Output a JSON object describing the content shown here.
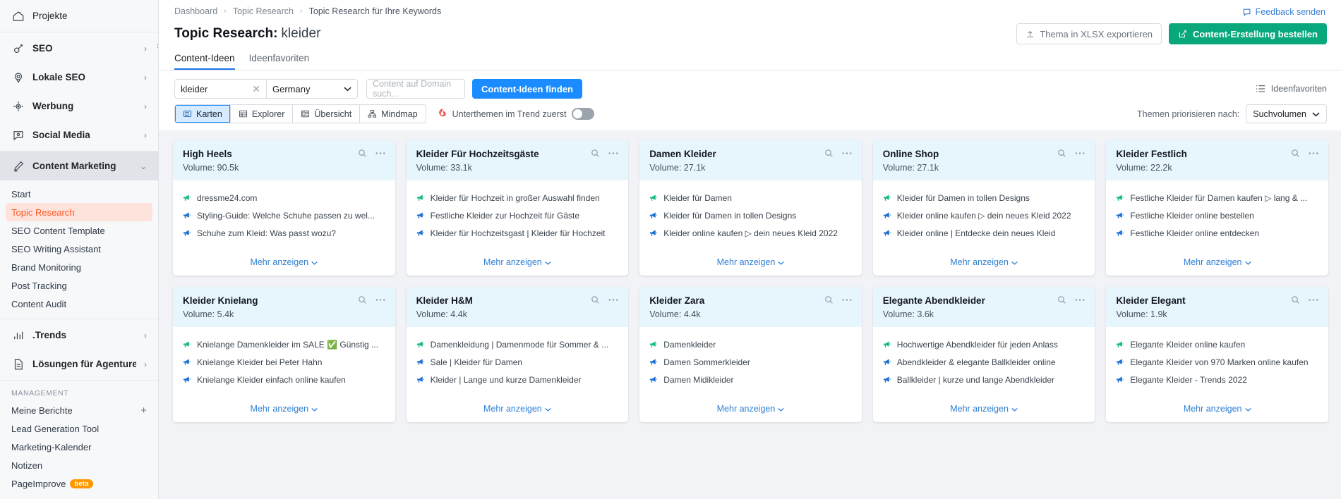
{
  "sidebar": {
    "groups": [
      {
        "items": [
          {
            "label": "Projekte",
            "icon": "home-icon",
            "chevron": false,
            "bold": false
          }
        ]
      },
      {
        "items": [
          {
            "label": "SEO",
            "icon": "seo-icon",
            "chevron": true,
            "bold": true
          },
          {
            "label": "Lokale SEO",
            "icon": "location-icon",
            "chevron": true,
            "bold": true
          },
          {
            "label": "Werbung",
            "icon": "target-icon",
            "chevron": true,
            "bold": true
          },
          {
            "label": "Social Media",
            "icon": "social-icon",
            "chevron": true,
            "bold": true
          }
        ]
      }
    ],
    "content_marketing": {
      "label": "Content Marketing",
      "icon": "pencil-icon",
      "expanded": true
    },
    "content_items": [
      {
        "label": "Start",
        "selected": false
      },
      {
        "label": "Topic Research",
        "selected": true
      },
      {
        "label": "SEO Content Template",
        "selected": false
      },
      {
        "label": "SEO Writing Assistant",
        "selected": false
      },
      {
        "label": "Brand Monitoring",
        "selected": false
      },
      {
        "label": "Post Tracking",
        "selected": false
      },
      {
        "label": "Content Audit",
        "selected": false
      }
    ],
    "bottom_groups": [
      {
        "label": ".Trends",
        "icon": "bars-icon",
        "chevron": true,
        "bold": true
      },
      {
        "label": "Lösungen für Agenturen",
        "icon": "document-icon",
        "chevron": true,
        "bold": true
      }
    ],
    "management_label": "MANAGEMENT",
    "management_items": [
      {
        "label": "Meine Berichte",
        "plus": true,
        "beta": false
      },
      {
        "label": "Lead Generation Tool",
        "plus": false,
        "beta": false
      },
      {
        "label": "Marketing-Kalender",
        "plus": false,
        "beta": false
      },
      {
        "label": "Notizen",
        "plus": false,
        "beta": false
      },
      {
        "label": "PageImprove",
        "plus": false,
        "beta": true,
        "beta_label": "beta"
      }
    ]
  },
  "header": {
    "breadcrumb": [
      "Dashboard",
      "Topic Research",
      "Topic Research für Ihre Keywords"
    ],
    "feedback_label": "Feedback senden",
    "title": "Topic Research:",
    "keyword": "kleider",
    "export_button": "Thema in XLSX exportieren",
    "order_button": "Content-Erstellung bestellen",
    "tabs": [
      {
        "label": "Content-Ideen",
        "active": true
      },
      {
        "label": "Ideenfavoriten",
        "active": false
      }
    ]
  },
  "filters": {
    "keyword_value": "kleider",
    "database_value": "Germany",
    "domain_placeholder": "Content auf Domain such...",
    "find_button": "Content-Ideen finden",
    "favorites_link": "Ideenfavoriten"
  },
  "viewbar": {
    "views": [
      {
        "label": "Karten",
        "icon": "cards-icon",
        "active": true
      },
      {
        "label": "Explorer",
        "icon": "table-icon",
        "active": false
      },
      {
        "label": "Übersicht",
        "icon": "overview-icon",
        "active": false
      },
      {
        "label": "Mindmap",
        "icon": "mindmap-icon",
        "active": false
      }
    ],
    "trend_label": "Unterthemen im Trend zuerst",
    "trend_on": false,
    "priority_label": "Themen priorisieren nach:",
    "priority_value": "Suchvolumen"
  },
  "cards": {
    "more_label": "Mehr anzeigen",
    "volume_prefix": "Volume:",
    "rows": [
      [
        {
          "title": "High Heels",
          "volume": "Volume: 90.5k",
          "ideas": [
            {
              "text": "dressme24.com",
              "color": "green"
            },
            {
              "text": "Styling-Guide: Welche Schuhe passen zu wel...",
              "color": "blue"
            },
            {
              "text": "Schuhe zum Kleid: Was passt wozu?",
              "color": "blue"
            }
          ]
        },
        {
          "title": "Kleider Für Hochzeitsgäste",
          "volume": "Volume: 33.1k",
          "ideas": [
            {
              "text": "Kleider für Hochzeit in großer Auswahl finden",
              "color": "green"
            },
            {
              "text": "Festliche Kleider zur Hochzeit für Gäste",
              "color": "blue"
            },
            {
              "text": "Kleider für Hochzeitsgast | Kleider für Hochzeit",
              "color": "blue"
            }
          ]
        },
        {
          "title": "Damen Kleider",
          "volume": "Volume: 27.1k",
          "ideas": [
            {
              "text": "Kleider für Damen",
              "color": "green"
            },
            {
              "text": "Kleider für Damen in tollen Designs",
              "color": "blue"
            },
            {
              "text": "Kleider online kaufen ▷ dein neues Kleid 2022",
              "color": "blue"
            }
          ]
        },
        {
          "title": "Online Shop",
          "volume": "Volume: 27.1k",
          "ideas": [
            {
              "text": "Kleider für Damen in tollen Designs",
              "color": "green"
            },
            {
              "text": "Kleider online kaufen ▷ dein neues Kleid 2022",
              "color": "blue"
            },
            {
              "text": "Kleider online | Entdecke dein neues Kleid",
              "color": "blue"
            }
          ]
        },
        {
          "title": "Kleider Festlich",
          "volume": "Volume: 22.2k",
          "ideas": [
            {
              "text": "Festliche Kleider für Damen kaufen ▷ lang & ...",
              "color": "green"
            },
            {
              "text": "Festliche Kleider online bestellen",
              "color": "blue"
            },
            {
              "text": "Festliche Kleider online entdecken",
              "color": "blue"
            }
          ]
        }
      ],
      [
        {
          "title": "Kleider Knielang",
          "volume": "Volume: 5.4k",
          "ideas": [
            {
              "text": "Knielange Damenkleider im SALE ✅ Günstig ...",
              "color": "green"
            },
            {
              "text": "Knielange Kleider bei Peter Hahn",
              "color": "blue"
            },
            {
              "text": "Knielange Kleider einfach online kaufen",
              "color": "blue"
            }
          ]
        },
        {
          "title": "Kleider H&M",
          "volume": "Volume: 4.4k",
          "ideas": [
            {
              "text": "Damenkleidung | Damenmode für Sommer & ...",
              "color": "green"
            },
            {
              "text": "Sale | Kleider für Damen",
              "color": "blue"
            },
            {
              "text": "Kleider | Lange und kurze Damenkleider",
              "color": "blue"
            }
          ]
        },
        {
          "title": "Kleider Zara",
          "volume": "Volume: 4.4k",
          "ideas": [
            {
              "text": "Damenkleider",
              "color": "green"
            },
            {
              "text": "Damen Sommerkleider",
              "color": "blue"
            },
            {
              "text": "Damen Midikleider",
              "color": "blue"
            }
          ]
        },
        {
          "title": "Elegante Abendkleider",
          "volume": "Volume: 3.6k",
          "ideas": [
            {
              "text": "Hochwertige Abendkleider für jeden Anlass",
              "color": "green"
            },
            {
              "text": "Abendkleider & elegante Ballkleider online",
              "color": "blue"
            },
            {
              "text": "Ballkleider | kurze und lange Abendkleider",
              "color": "blue"
            }
          ]
        },
        {
          "title": "Kleider Elegant",
          "volume": "Volume: 1.9k",
          "ideas": [
            {
              "text": "Elegante Kleider online kaufen",
              "color": "green"
            },
            {
              "text": "Elegante Kleider von 970 Marken online kaufen",
              "color": "blue"
            },
            {
              "text": "Elegante Kleider - Trends 2022",
              "color": "blue"
            }
          ]
        }
      ]
    ]
  },
  "colors": {
    "accent_blue": "#1a8cff",
    "green": "#08a87c",
    "selected_orange": "#ff5722",
    "card_header": "#e7f5fd"
  }
}
